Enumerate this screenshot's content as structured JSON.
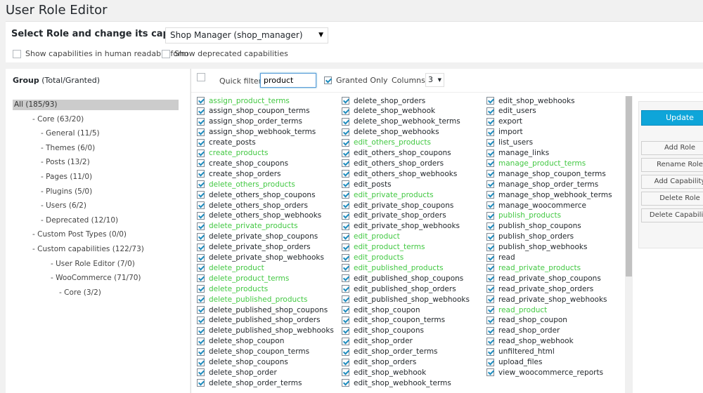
{
  "page": {
    "title": "User Role Editor"
  },
  "role": {
    "label": "Select Role and change its capabilities:",
    "selected": "Shop Manager (shop_manager)",
    "opt_human_readable": "Show capabilities in human readable form",
    "opt_deprecated": "Show deprecated capabilities"
  },
  "groups": {
    "header_bold": "Group",
    "header_rest": "(Total/Granted)",
    "items": [
      {
        "label": "All (185/93)",
        "level": 0,
        "selected": true
      },
      {
        "label": "- Core (63/20)",
        "level": 1
      },
      {
        "label": "- General (11/5)",
        "level": 2
      },
      {
        "label": "- Themes (6/0)",
        "level": 2
      },
      {
        "label": "- Posts (13/2)",
        "level": 2
      },
      {
        "label": "- Pages (11/0)",
        "level": 2
      },
      {
        "label": "- Plugins (5/0)",
        "level": 2
      },
      {
        "label": "- Users (6/2)",
        "level": 2
      },
      {
        "label": "- Deprecated (12/10)",
        "level": 2
      },
      {
        "label": "- Custom Post Types (0/0)",
        "level": 1
      },
      {
        "label": "- Custom capabilities (122/73)",
        "level": 1
      },
      {
        "label": "- User Role Editor (7/0)",
        "level": 3
      },
      {
        "label": "- WooCommerce (71/70)",
        "level": 3
      },
      {
        "label": "- Core (3/2)",
        "level": 4
      }
    ]
  },
  "filter": {
    "quick_filter_label": "Quick filter:",
    "quick_filter_value": "product",
    "granted_only_label": "Granted Only",
    "columns_label": "Columns:",
    "columns_value": "3"
  },
  "capabilities": {
    "col1": [
      {
        "name": "assign_product_terms",
        "green": true
      },
      {
        "name": "assign_shop_coupon_terms"
      },
      {
        "name": "assign_shop_order_terms"
      },
      {
        "name": "assign_shop_webhook_terms"
      },
      {
        "name": "create_posts"
      },
      {
        "name": "create_products",
        "green": true
      },
      {
        "name": "create_shop_coupons"
      },
      {
        "name": "create_shop_orders"
      },
      {
        "name": "delete_others_products",
        "green": true
      },
      {
        "name": "delete_others_shop_coupons"
      },
      {
        "name": "delete_others_shop_orders"
      },
      {
        "name": "delete_others_shop_webhooks"
      },
      {
        "name": "delete_private_products",
        "green": true
      },
      {
        "name": "delete_private_shop_coupons"
      },
      {
        "name": "delete_private_shop_orders"
      },
      {
        "name": "delete_private_shop_webhooks"
      },
      {
        "name": "delete_product",
        "green": true
      },
      {
        "name": "delete_product_terms",
        "green": true
      },
      {
        "name": "delete_products",
        "green": true
      },
      {
        "name": "delete_published_products",
        "green": true
      },
      {
        "name": "delete_published_shop_coupons"
      },
      {
        "name": "delete_published_shop_orders"
      },
      {
        "name": "delete_published_shop_webhooks"
      },
      {
        "name": "delete_shop_coupon"
      },
      {
        "name": "delete_shop_coupon_terms"
      },
      {
        "name": "delete_shop_coupons"
      },
      {
        "name": "delete_shop_order"
      },
      {
        "name": "delete_shop_order_terms"
      }
    ],
    "col2": [
      {
        "name": "delete_shop_orders"
      },
      {
        "name": "delete_shop_webhook"
      },
      {
        "name": "delete_shop_webhook_terms"
      },
      {
        "name": "delete_shop_webhooks"
      },
      {
        "name": "edit_others_products",
        "green": true
      },
      {
        "name": "edit_others_shop_coupons"
      },
      {
        "name": "edit_others_shop_orders"
      },
      {
        "name": "edit_others_shop_webhooks"
      },
      {
        "name": "edit_posts"
      },
      {
        "name": "edit_private_products",
        "green": true
      },
      {
        "name": "edit_private_shop_coupons"
      },
      {
        "name": "edit_private_shop_orders"
      },
      {
        "name": "edit_private_shop_webhooks"
      },
      {
        "name": "edit_product",
        "green": true
      },
      {
        "name": "edit_product_terms",
        "green": true
      },
      {
        "name": "edit_products",
        "green": true
      },
      {
        "name": "edit_published_products",
        "green": true
      },
      {
        "name": "edit_published_shop_coupons"
      },
      {
        "name": "edit_published_shop_orders"
      },
      {
        "name": "edit_published_shop_webhooks"
      },
      {
        "name": "edit_shop_coupon"
      },
      {
        "name": "edit_shop_coupon_terms"
      },
      {
        "name": "edit_shop_coupons"
      },
      {
        "name": "edit_shop_order"
      },
      {
        "name": "edit_shop_order_terms"
      },
      {
        "name": "edit_shop_orders"
      },
      {
        "name": "edit_shop_webhook"
      },
      {
        "name": "edit_shop_webhook_terms"
      }
    ],
    "col3": [
      {
        "name": "edit_shop_webhooks"
      },
      {
        "name": "edit_users"
      },
      {
        "name": "export"
      },
      {
        "name": "import"
      },
      {
        "name": "list_users"
      },
      {
        "name": "manage_links"
      },
      {
        "name": "manage_product_terms",
        "green": true
      },
      {
        "name": "manage_shop_coupon_terms"
      },
      {
        "name": "manage_shop_order_terms"
      },
      {
        "name": "manage_shop_webhook_terms"
      },
      {
        "name": "manage_woocommerce"
      },
      {
        "name": "publish_products",
        "green": true
      },
      {
        "name": "publish_shop_coupons"
      },
      {
        "name": "publish_shop_orders"
      },
      {
        "name": "publish_shop_webhooks"
      },
      {
        "name": "read"
      },
      {
        "name": "read_private_products",
        "green": true
      },
      {
        "name": "read_private_shop_coupons"
      },
      {
        "name": "read_private_shop_orders"
      },
      {
        "name": "read_private_shop_webhooks"
      },
      {
        "name": "read_product",
        "green": true
      },
      {
        "name": "read_shop_coupon"
      },
      {
        "name": "read_shop_order"
      },
      {
        "name": "read_shop_webhook"
      },
      {
        "name": "unfiltered_html"
      },
      {
        "name": "upload_files"
      },
      {
        "name": "view_woocommerce_reports"
      }
    ]
  },
  "actions": {
    "update": "Update",
    "add_role": "Add Role",
    "rename_role": "Rename Role",
    "add_capability": "Add Capability",
    "delete_role": "Delete Role",
    "delete_capability": "Delete Capability"
  },
  "colors": {
    "accent": "#1e8cbe",
    "match": "#42c842",
    "primary_button": "#0ea5d9"
  }
}
